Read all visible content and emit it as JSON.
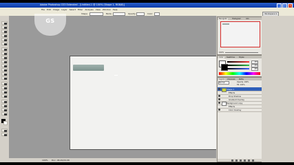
{
  "window": {
    "title": "Adobe Photoshop CS3 Extended - [Untitled-1 @ 100% (Shape 1, RGB/8)]",
    "buttons": [
      "_",
      "□",
      "x"
    ]
  },
  "menu": [
    "File",
    "Edit",
    "Image",
    "Layer",
    "Select",
    "Filter",
    "Analysis",
    "View",
    "Window",
    "Help"
  ],
  "options": {
    "shape_label": "Shape:",
    "mode_label": "Mode:",
    "opacity_label": "Opacity:",
    "color_label": "Color:",
    "workspace": "Workspace ▾"
  },
  "watermark": "GS",
  "status": {
    "zoom": "100%",
    "doc": "Doc: 46.2K/24.0K"
  },
  "navigator": {
    "tabs": [
      "Navigator",
      "Histogram",
      "Info"
    ],
    "zoom": "100%"
  },
  "color_panel": {
    "tabs": [
      "Color",
      "Swatches",
      "Styles"
    ],
    "values": [
      "255",
      "255",
      "255"
    ],
    "ramp_colors": [
      "#ff3a3a",
      "#2fc44a",
      "#3a5cff"
    ]
  },
  "layers": {
    "tabs": [
      "Layers",
      "Channels",
      "Paths"
    ],
    "blend_mode": "Normal",
    "opacity": "Opacity: 100%",
    "fill": "Fill: 100%",
    "rows": [
      {
        "name": "Shape 1",
        "selected": true,
        "kind": "pattern"
      },
      {
        "name": "Effects",
        "selected": false,
        "kind": "fx"
      },
      {
        "name": "Drop Shadow",
        "selected": false,
        "kind": "fx"
      },
      {
        "name": "Gradient Overlay",
        "selected": false,
        "kind": "fx"
      },
      {
        "name": "Background copy",
        "selected": false,
        "kind": "white"
      },
      {
        "name": "Effects",
        "selected": false,
        "kind": "fx"
      },
      {
        "name": "Color Overlay",
        "selected": false,
        "kind": "fx"
      }
    ]
  },
  "colors": {
    "title_bar": "#0b3aa8",
    "canvas_bg": "#9a9a9a",
    "document": "#f2f2f0",
    "shape": "#8fa39e",
    "selected_layer": "#2f5fb9",
    "navigator_box": "#d42a2a"
  }
}
